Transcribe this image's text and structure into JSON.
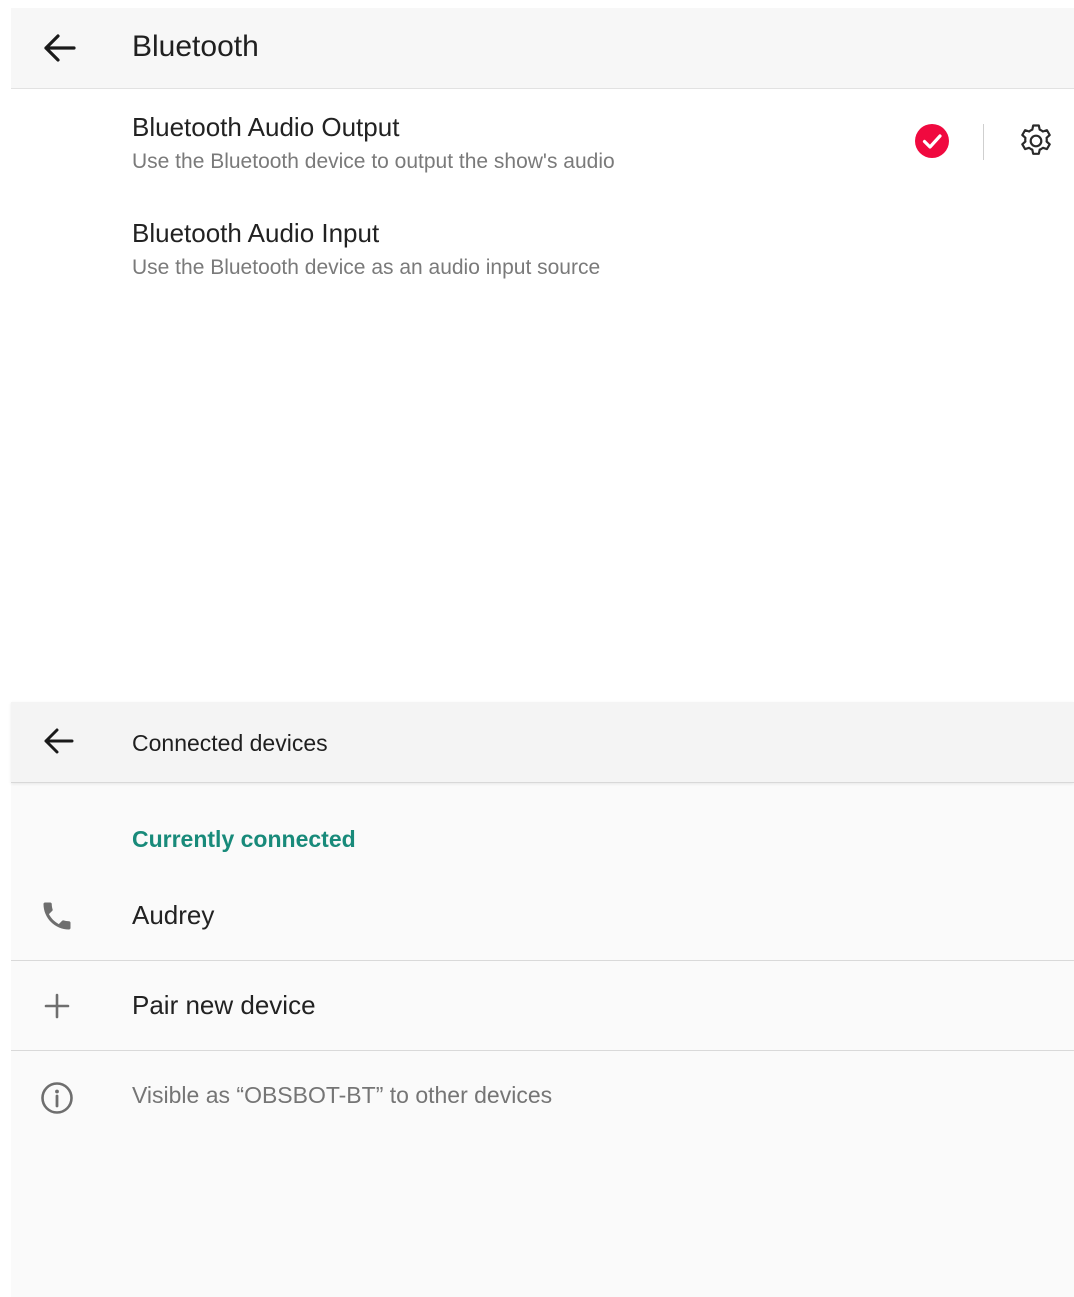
{
  "bluetooth_panel": {
    "title": "Bluetooth",
    "back_icon": "arrow-left-icon",
    "options": [
      {
        "title": "Bluetooth Audio Output",
        "subtitle": "Use the Bluetooth device to output the show's audio",
        "selected": true
      },
      {
        "title": "Bluetooth Audio Input",
        "subtitle": "Use the Bluetooth device as an audio input source",
        "selected": false
      }
    ],
    "check_icon": "check-circle-icon",
    "settings_icon": "gear-icon",
    "accent_color": "#f0093f"
  },
  "connected_panel": {
    "title": "Connected devices",
    "back_icon": "arrow-left-icon",
    "section_header": "Currently connected",
    "section_color": "#188a7a",
    "devices": [
      {
        "name": "Audrey",
        "icon": "phone-icon"
      }
    ],
    "pair_label": "Pair new device",
    "pair_icon": "plus-icon",
    "visibility_text": "Visible as “OBSBOT-BT” to other devices",
    "info_icon": "info-icon"
  }
}
